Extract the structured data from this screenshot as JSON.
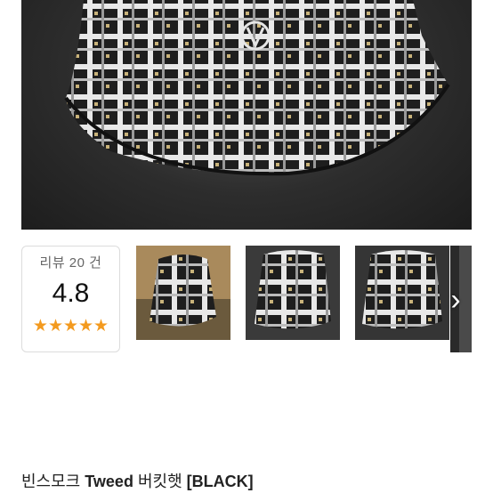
{
  "product": {
    "title_prefix": "빈스모크",
    "title_bold": "Tweed",
    "title_mid": "버킷햇",
    "title_suffix": "[BLACK]"
  },
  "reviews": {
    "count_label": "리뷰 20 건",
    "rating": "4.8",
    "stars_display": "★★★★★",
    "rating_value": 4.8,
    "rating_max": 5
  },
  "gallery": {
    "thumbnails": [
      "product-photo-1",
      "product-photo-2",
      "product-photo-3",
      "product-photo-4"
    ],
    "next_icon": "chevron-right-icon"
  },
  "colors": {
    "star": "#f39a1f",
    "text": "#222222",
    "border": "#dcdcdc"
  }
}
